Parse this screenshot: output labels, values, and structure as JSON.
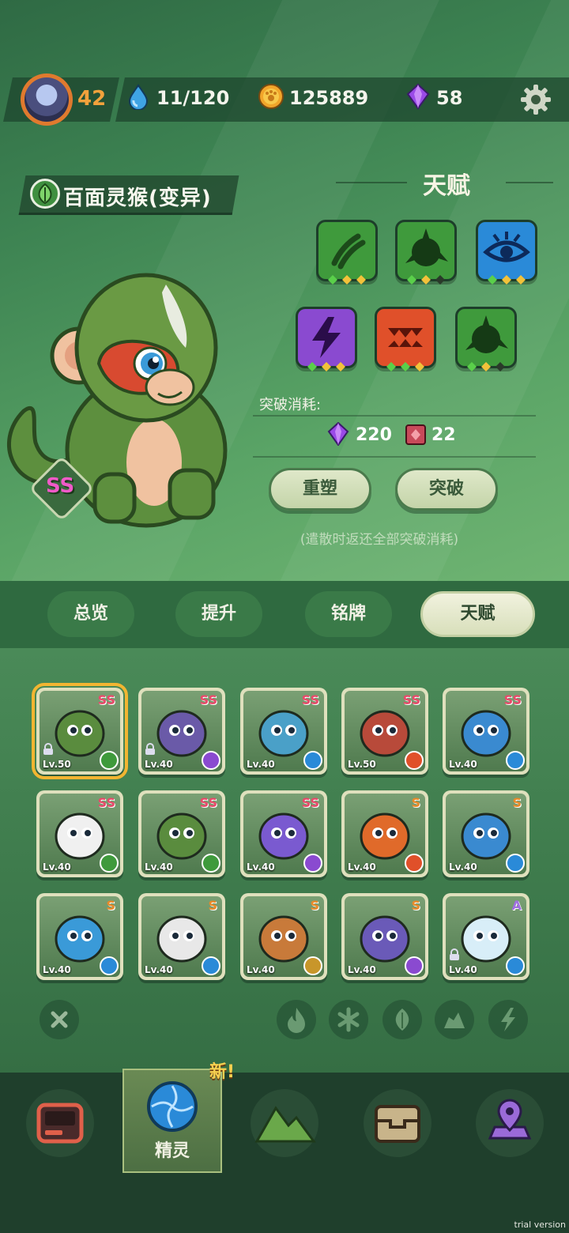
{
  "header": {
    "player_level": "42",
    "stamina": "11/120",
    "coins": "125889",
    "gems": "58"
  },
  "pet": {
    "name": "百面灵猴(变异)",
    "rank": "SS"
  },
  "talent": {
    "title": "天赋",
    "cost_label": "突破消耗:",
    "cost_gem": "220",
    "cost_card": "22",
    "reset_button": "重塑",
    "break_button": "突破",
    "hint": "(遣散时返还全部突破消耗)"
  },
  "tabs": [
    "总览",
    "提升",
    "铭牌",
    "天赋"
  ],
  "pets": [
    {
      "rank": "SS",
      "level": "Lv.50",
      "element": "leaf",
      "locked": true,
      "selected": true,
      "color": "#5a8c3e"
    },
    {
      "rank": "SS",
      "level": "Lv.40",
      "element": "thunder",
      "locked": true,
      "selected": false,
      "color": "#6a5aa8"
    },
    {
      "rank": "SS",
      "level": "Lv.40",
      "element": "ice",
      "locked": false,
      "selected": false,
      "color": "#4aa0c8"
    },
    {
      "rank": "SS",
      "level": "Lv.50",
      "element": "fire",
      "locked": false,
      "selected": false,
      "color": "#b84a3a"
    },
    {
      "rank": "SS",
      "level": "Lv.40",
      "element": "ice",
      "locked": false,
      "selected": false,
      "color": "#3a8ad0"
    },
    {
      "rank": "SS",
      "level": "Lv.40",
      "element": "leaf",
      "locked": false,
      "selected": false,
      "color": "#f0f0f0"
    },
    {
      "rank": "SS",
      "level": "Lv.40",
      "element": "leaf",
      "locked": false,
      "selected": false,
      "color": "#5a8c3e"
    },
    {
      "rank": "SS",
      "level": "Lv.40",
      "element": "thunder",
      "locked": false,
      "selected": false,
      "color": "#7a5ad0"
    },
    {
      "rank": "S",
      "level": "Lv.40",
      "element": "fire",
      "locked": false,
      "selected": false,
      "color": "#e06a2a"
    },
    {
      "rank": "S",
      "level": "Lv.40",
      "element": "ice",
      "locked": false,
      "selected": false,
      "color": "#3a8ad0"
    },
    {
      "rank": "S",
      "level": "Lv.40",
      "element": "ice",
      "locked": false,
      "selected": false,
      "color": "#3a9ad8"
    },
    {
      "rank": "S",
      "level": "Lv.40",
      "element": "ice",
      "locked": false,
      "selected": false,
      "color": "#e8e8e8"
    },
    {
      "rank": "S",
      "level": "Lv.40",
      "element": "rock",
      "locked": false,
      "selected": false,
      "color": "#c87a3a"
    },
    {
      "rank": "S",
      "level": "Lv.40",
      "element": "thunder",
      "locked": false,
      "selected": false,
      "color": "#6a5ab8"
    },
    {
      "rank": "A",
      "level": "Lv.40",
      "element": "ice",
      "locked": true,
      "selected": false,
      "color": "#d8eef8"
    }
  ],
  "nav": {
    "active_label": "精灵",
    "new_badge": "新!"
  },
  "watermark": "trial version",
  "colors": {
    "leaf": "#3f9a3c",
    "thunder": "#8a4ad0",
    "ice": "#2a8ad8",
    "fire": "#e0502a",
    "rock": "#c8962a"
  }
}
